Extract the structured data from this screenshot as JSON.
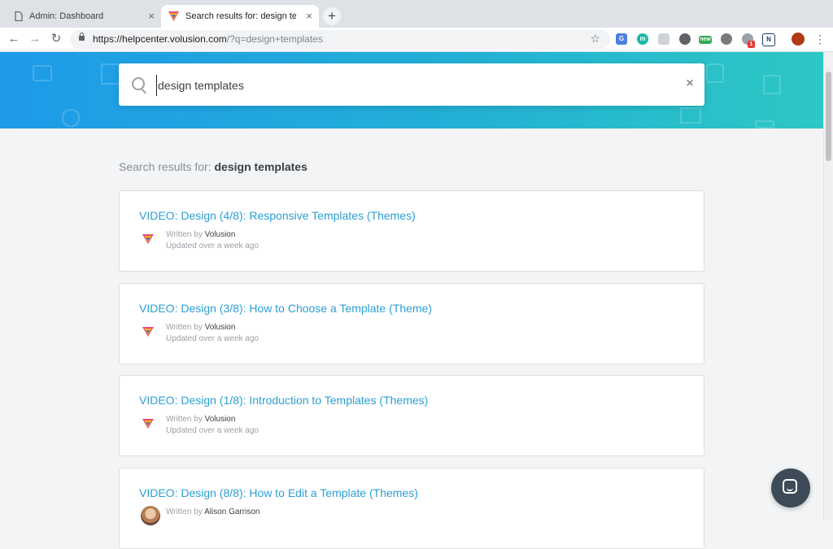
{
  "browser": {
    "tabs": [
      {
        "title": "Admin: Dashboard",
        "close": "×"
      },
      {
        "title": "Search results for: design templ",
        "close": "×"
      }
    ],
    "new_tab": "+",
    "url_host": "https://helpcenter.volusion.com",
    "url_path": "/?q=design+templates",
    "extensions": [
      {
        "name": "translate-icon",
        "label": "G",
        "color": "#4a7fe0"
      },
      {
        "name": "m-extension-icon",
        "label": "m",
        "color": "#19b8a6"
      },
      {
        "name": "chat-extension-icon",
        "label": "",
        "color": "#9aa0a6"
      },
      {
        "name": "film-extension-icon",
        "label": "",
        "color": "#5f6368"
      },
      {
        "name": "new-extension-icon",
        "label": "new",
        "color": "#34a853"
      },
      {
        "name": "mask-extension-icon",
        "label": "",
        "color": "#7a7a7a"
      },
      {
        "name": "badge-extension-icon",
        "label": "1",
        "color": "#e53935"
      },
      {
        "name": "n-extension-icon",
        "label": "N",
        "color": "#1a3b6e"
      },
      {
        "name": "profile-avatar",
        "label": "",
        "color": "#b03a16"
      }
    ]
  },
  "search": {
    "query": "design templates",
    "clear_label": "×"
  },
  "results": {
    "heading_prefix": "Search results for:",
    "heading_query": "design templates",
    "items": [
      {
        "title": "VIDEO: Design (4/8): Responsive Templates (Themes)",
        "written_by": "Written by",
        "author": "Volusion",
        "updated": "Updated over a week ago"
      },
      {
        "title": "VIDEO: Design (3/8): How to Choose a Template (Theme)",
        "written_by": "Written by",
        "author": "Volusion",
        "updated": "Updated over a week ago"
      },
      {
        "title": "VIDEO: Design (1/8): Introduction to Templates (Themes)",
        "written_by": "Written by",
        "author": "Volusion",
        "updated": "Updated over a week ago"
      },
      {
        "title": "VIDEO: Design (8/8): How to Edit a Template (Themes)",
        "written_by": "Written by",
        "author": "Alison Garrison",
        "updated": ""
      }
    ]
  }
}
